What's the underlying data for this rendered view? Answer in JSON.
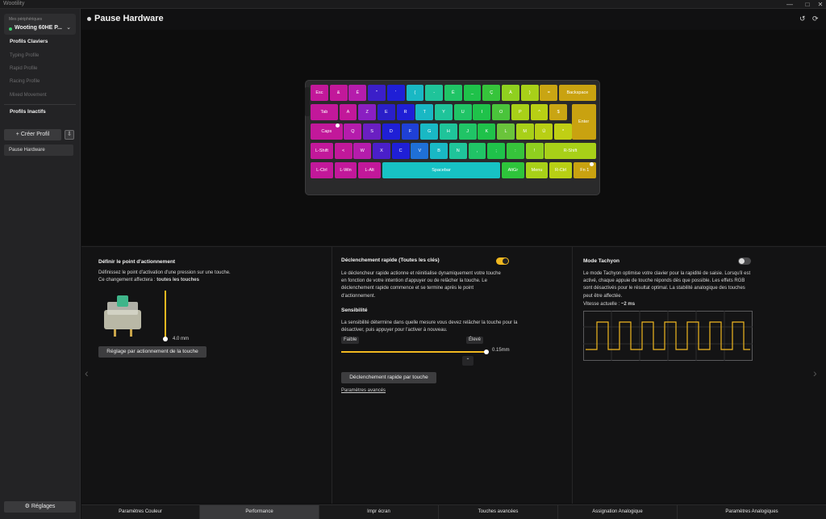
{
  "app": {
    "title": "Wootility"
  },
  "sidebar": {
    "device_label": "Mes périphériques",
    "device_name": "Wooting 60HE P...",
    "section_keyboard": "Profils Claviers",
    "profiles": [
      "Typing Profile",
      "Rapid Profile",
      "Racing Profile",
      "Mixed Movement"
    ],
    "section_inactive": "Profils Inactifs",
    "create_label": "Créer Profil",
    "active_profile": "Pause Hardware",
    "settings_label": "Réglages"
  },
  "header": {
    "title": "Pause Hardware"
  },
  "keyboard": {
    "rows": [
      [
        {
          "l": "Esc",
          "c": "#c2189a"
        },
        {
          "l": "&",
          "c": "#c2189a"
        },
        {
          "l": "É",
          "c": "#b51cac"
        },
        {
          "l": "\"",
          "c": "#3b1fc9"
        },
        {
          "l": "'",
          "c": "#1f1fd6"
        },
        {
          "l": "(",
          "c": "#19b8c4"
        },
        {
          "l": "-",
          "c": "#1fc49a"
        },
        {
          "l": "È",
          "c": "#20c466"
        },
        {
          "l": "_",
          "c": "#1fc24a"
        },
        {
          "l": "Ç",
          "c": "#36c43b"
        },
        {
          "l": "À",
          "c": "#8fd01f"
        },
        {
          "l": ")",
          "c": "#a8d018"
        },
        {
          "l": "=",
          "c": "#c9a513"
        },
        {
          "l": "Backspace",
          "c": "#c9a210"
        }
      ],
      [
        {
          "l": "Tab",
          "c": "#c2189a"
        },
        {
          "l": "A",
          "c": "#c2189a"
        },
        {
          "l": "Z",
          "c": "#8a1fc2"
        },
        {
          "l": "E",
          "c": "#2a1fc9"
        },
        {
          "l": "R",
          "c": "#1f1fd6"
        },
        {
          "l": "T",
          "c": "#19b8c4"
        },
        {
          "l": "Y",
          "c": "#1fc49a"
        },
        {
          "l": "U",
          "c": "#20c466"
        },
        {
          "l": "I",
          "c": "#1fc24a"
        },
        {
          "l": "O",
          "c": "#4ac43b"
        },
        {
          "l": "P",
          "c": "#a8d018"
        },
        {
          "l": "^",
          "c": "#b8cf14"
        },
        {
          "l": "$",
          "c": "#c9a513"
        },
        {
          "l": "Enter",
          "c": "#c9a210"
        }
      ],
      [
        {
          "l": "Caps",
          "c": "#c2189a"
        },
        {
          "l": "Q",
          "c": "#b51cac"
        },
        {
          "l": "S",
          "c": "#6a1fc2"
        },
        {
          "l": "D",
          "c": "#1f1fd6"
        },
        {
          "l": "F",
          "c": "#1f40d6"
        },
        {
          "l": "G",
          "c": "#19b8c4"
        },
        {
          "l": "H",
          "c": "#1fc49a"
        },
        {
          "l": "J",
          "c": "#20c466"
        },
        {
          "l": "K",
          "c": "#1fc24a"
        },
        {
          "l": "L",
          "c": "#6ac43b"
        },
        {
          "l": "M",
          "c": "#a8d018"
        },
        {
          "l": "Ù",
          "c": "#b8cf14"
        },
        {
          "l": "*",
          "c": "#c0cf14"
        }
      ],
      [
        {
          "l": "L-Shift",
          "c": "#c2189a"
        },
        {
          "l": "<",
          "c": "#c2189a"
        },
        {
          "l": "W",
          "c": "#b51cac"
        },
        {
          "l": "X",
          "c": "#4a1fc9"
        },
        {
          "l": "C",
          "c": "#1f1fd6"
        },
        {
          "l": "V",
          "c": "#1f70d6"
        },
        {
          "l": "B",
          "c": "#19b8c4"
        },
        {
          "l": "N",
          "c": "#1fc49a"
        },
        {
          "l": ",",
          "c": "#20c466"
        },
        {
          "l": ";",
          "c": "#1fc24a"
        },
        {
          "l": ":",
          "c": "#36c43b"
        },
        {
          "l": "!",
          "c": "#8fd01f"
        },
        {
          "l": "R-Shift",
          "c": "#a8d018"
        }
      ],
      [
        {
          "l": "L-Ctrl",
          "c": "#c2189a"
        },
        {
          "l": "L-Win",
          "c": "#c2189a"
        },
        {
          "l": "L-Alt",
          "c": "#c2189a"
        },
        {
          "l": "Spacebar",
          "c": "#17c2c4"
        },
        {
          "l": "AltGr",
          "c": "#2ec43b"
        },
        {
          "l": "Menu",
          "c": "#a8d018"
        },
        {
          "l": "R-Ctrl",
          "c": "#b8cf14"
        },
        {
          "l": "Fn 1",
          "c": "#c9a210"
        }
      ]
    ]
  },
  "actuation": {
    "title": "Définir le point d'actionnement",
    "desc_1": "Définissez le point d'activation d'une pression sur une touche.",
    "desc_2": "Ce changement affectera : ",
    "desc_2_bold": "toutes les touches",
    "value": "4.0 mm",
    "value_mm": 4.0,
    "button": "Réglage par actionnement de la touche"
  },
  "rapid_trigger": {
    "title": "Déclenchement rapide (Toutes les clés)",
    "enabled": true,
    "desc": "Le déclencheur rapide actionne et réinitialise dynamiquement votre touche en fonction de votre intention d'appuyer ou de relâcher la touche. Le déclenchement rapide commence et se termine après le point d'actionnement.",
    "sens_title": "Sensibilité",
    "sens_desc": "La sensibilité détermine dans quelle mesure vous devez relâcher la touche pour la désactiver, puis appuyer pour l'activer à nouveau.",
    "low": "Faible",
    "high": "Élevé",
    "value": "0.15mm",
    "value_mm": 0.15,
    "button": "Déclenchement rapide par touche",
    "advanced": "Paramètres avancés"
  },
  "tachyon": {
    "title": "Mode Tachyon",
    "enabled": false,
    "desc": "Le mode Tachyon optimise votre clavier pour la rapidité de saisie. Lorsqu'il est activé, chaque appuie de touche réponds dès que possible. Les effets RGB sont désactivés pour le résultat optimal. La stabilité analogique des touches peut être affectée.",
    "speed_label": "Vitesse actuelle : ",
    "speed_value": "~2 ms"
  },
  "tabs": [
    "Paramètres Couleur",
    "Performance",
    "Impr écran",
    "Touches avancées",
    "Assignation Analogique",
    "Paramètres Analogiques"
  ],
  "active_tab": "Performance",
  "colors": {
    "accent": "#f0b820",
    "key_underlay": "#2a2a2b"
  }
}
